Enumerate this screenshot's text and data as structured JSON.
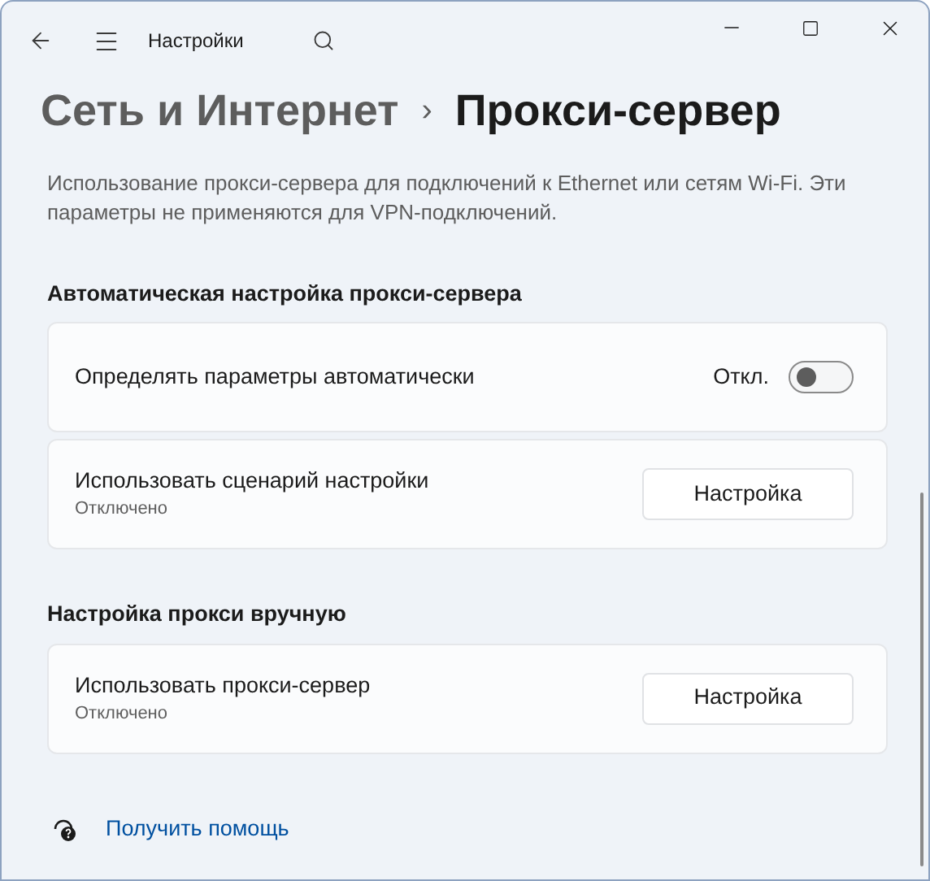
{
  "window": {
    "title": "Настройки"
  },
  "breadcrumb": {
    "parent": "Сеть и Интернет",
    "separator": "›",
    "current": "Прокси-сервер"
  },
  "description": "Использование прокси-сервера для подключений к Ethernet или сетям Wi-Fi. Эти параметры не применяются для VPN-подключений.",
  "sections": [
    {
      "title": "Автоматическая настройка прокси-сервера",
      "rows": [
        {
          "kind": "toggle",
          "label": "Определять параметры автоматически",
          "state_label": "Откл.",
          "on": false
        },
        {
          "kind": "button",
          "label": "Использовать сценарий настройки",
          "status": "Отключено",
          "button": "Настройка"
        }
      ]
    },
    {
      "title": "Настройка прокси вручную",
      "rows": [
        {
          "kind": "button",
          "label": "Использовать прокси-сервер",
          "status": "Отключено",
          "button": "Настройка"
        }
      ]
    }
  ],
  "help_link": "Получить помощь"
}
